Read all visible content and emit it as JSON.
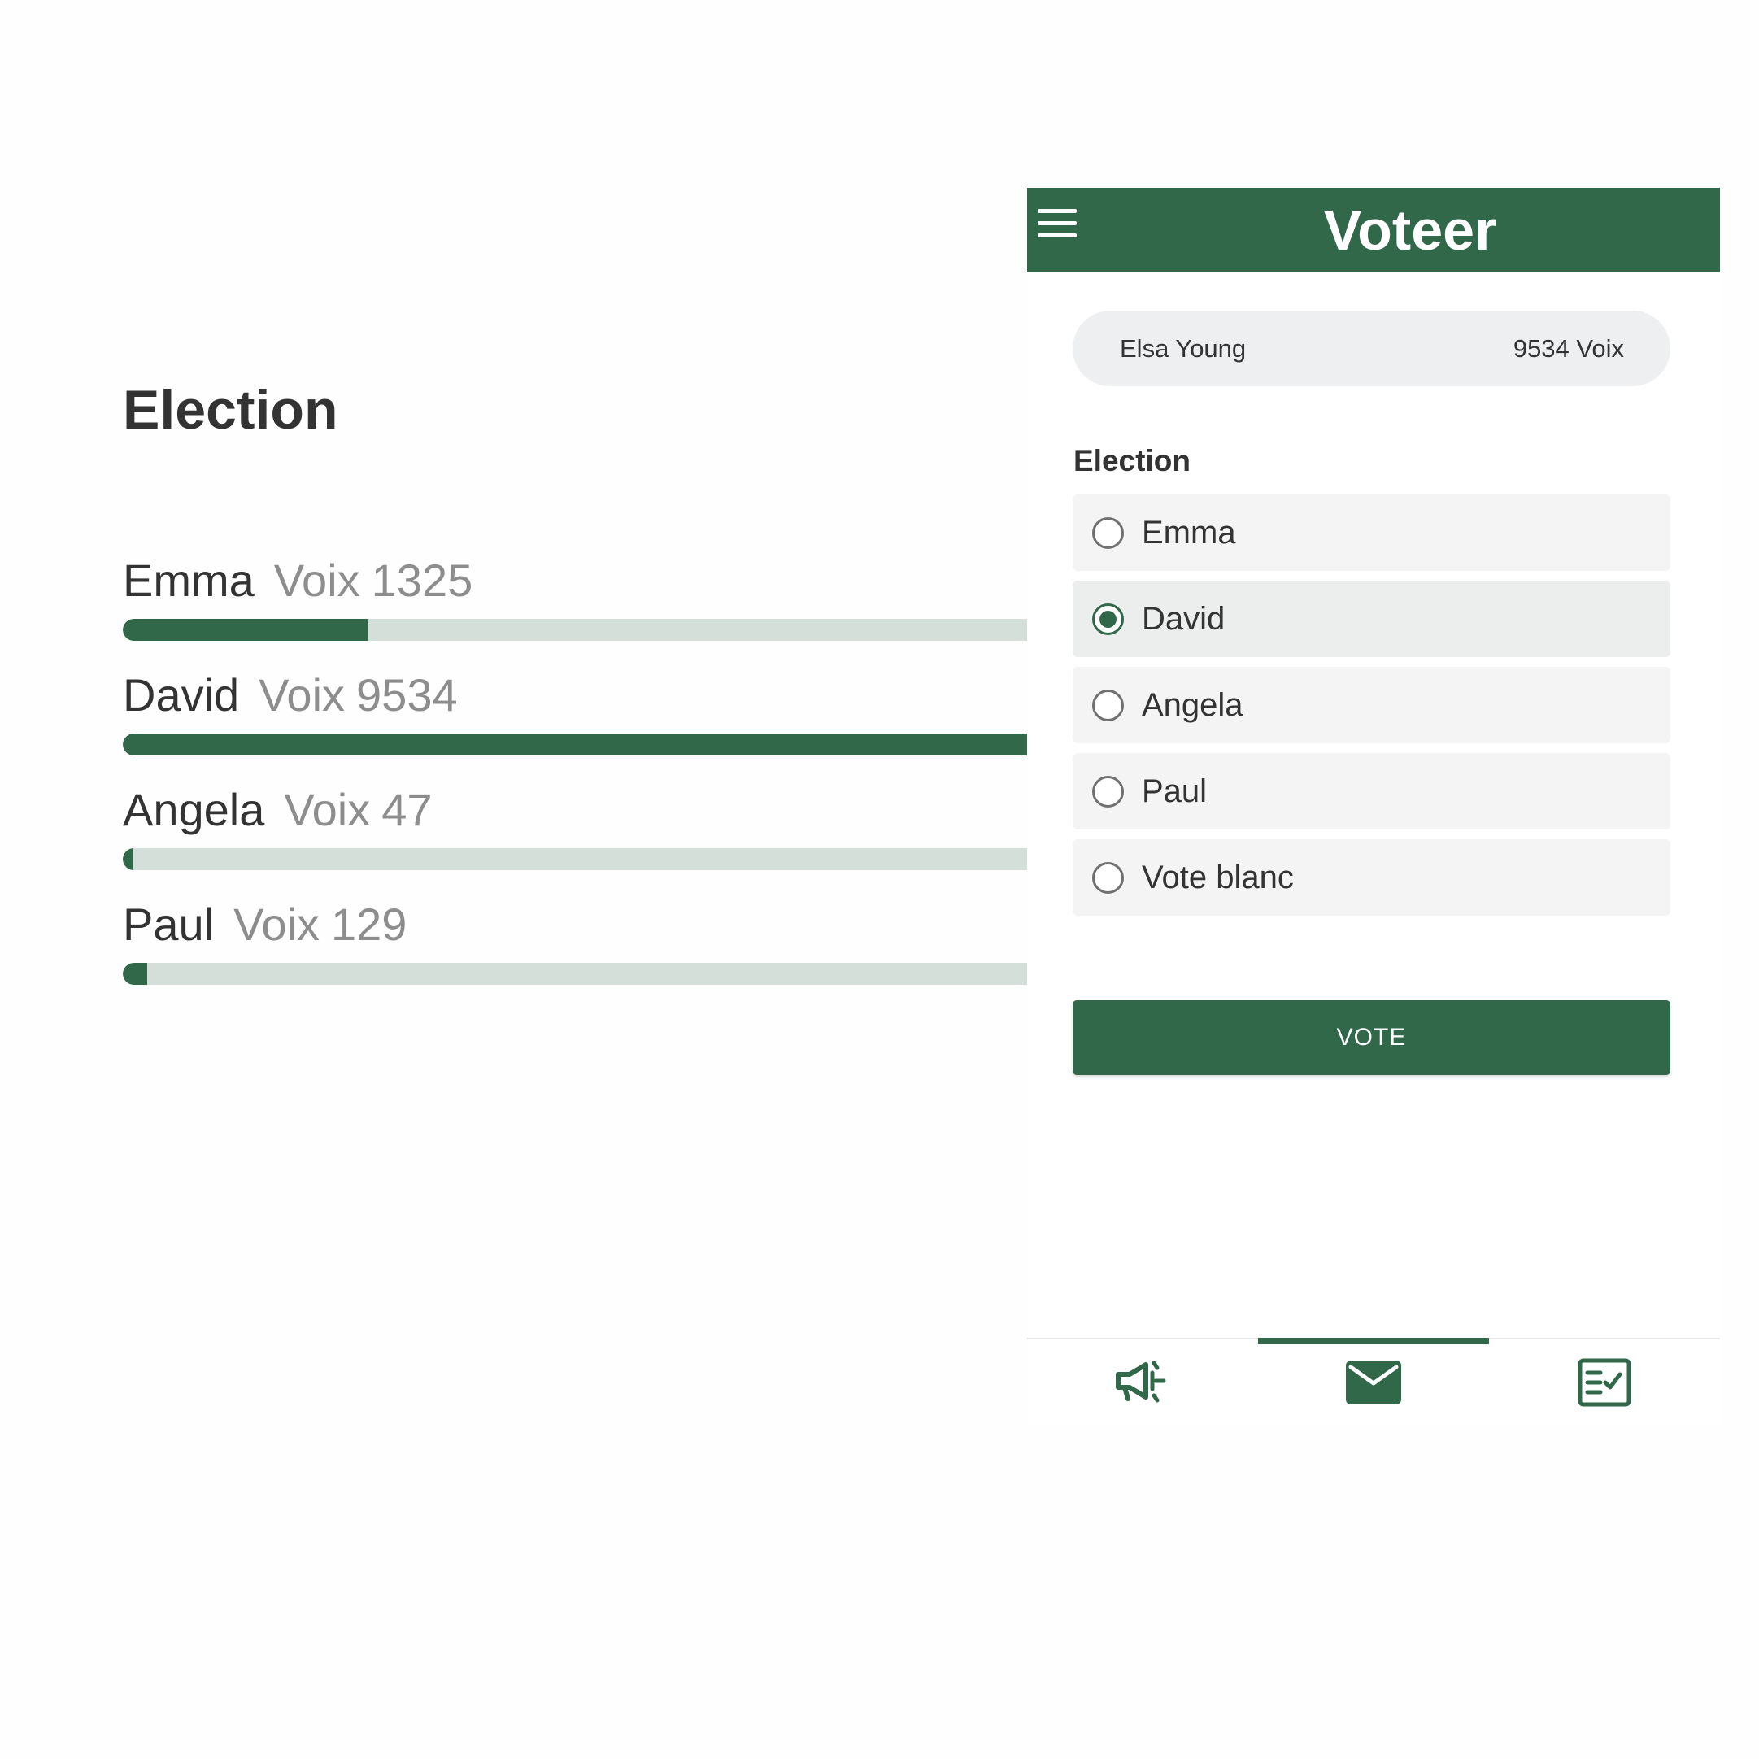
{
  "colors": {
    "brand": "#31684a",
    "bar_track": "#d3dfd8",
    "pill_bg": "#eeeff0",
    "option_bg": "#f4f4f5"
  },
  "results": {
    "title": "Election",
    "max_votes": 9534,
    "items": [
      {
        "name": "Emma",
        "votes_label": "Voix",
        "votes": 1325,
        "share": 0.272
      },
      {
        "name": "David",
        "votes_label": "Voix",
        "votes": 9534,
        "share": 1.0
      },
      {
        "name": "Angela",
        "votes_label": "Voix",
        "votes": 47,
        "share": 0.012
      },
      {
        "name": "Paul",
        "votes_label": "Voix",
        "votes": 129,
        "share": 0.027
      }
    ]
  },
  "app": {
    "title": "Voteer",
    "menu_icon": "hamburger-menu-icon",
    "user": {
      "name": "Elsa Young",
      "votes": "9534 Voix"
    },
    "form": {
      "label": "Election",
      "options": [
        {
          "label": "Emma",
          "selected": false
        },
        {
          "label": "David",
          "selected": true
        },
        {
          "label": "Angela",
          "selected": false
        },
        {
          "label": "Paul",
          "selected": false
        },
        {
          "label": "Vote blanc",
          "selected": false
        }
      ],
      "submit_label": "VOTE"
    },
    "nav": {
      "tabs": [
        {
          "icon": "megaphone-icon",
          "active": false
        },
        {
          "icon": "envelope-icon",
          "active": true
        },
        {
          "icon": "checklist-icon",
          "active": false
        }
      ]
    }
  }
}
